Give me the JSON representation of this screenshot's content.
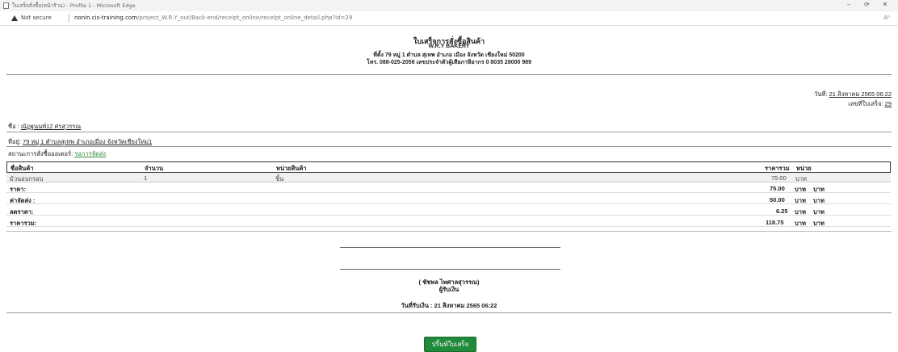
{
  "window": {
    "title": "ใบเสร็จสั่งซื้อ(หน้าร้าน) - Profile 1 - Microsoft Edge",
    "minimize": "–",
    "restore": "⟳",
    "close": "✕"
  },
  "addressbar": {
    "security_label": "Not secure",
    "url_host": "nonin.cis-training.com",
    "url_path": "/project_W.R.Y_out/Back-end/receipt_online/receipt_online_detail.php?id=29",
    "reader_label": "Aᵇ"
  },
  "header": {
    "title": "ใบเสร็จการสั่งซื้อสินค้า",
    "shop_name": "W.R.Y BAKERY",
    "address": "ที่ตั้ง 79 หมู่ 1 ตำบล สุเทพ อำเภอ เมือง จังหวัด เชียงใหม่ 50200",
    "contact": "โทร. 088-025-2056 เลขประจำตัวผู้เสียภาษีอากร 0 8035 28000 989"
  },
  "receipt_meta": {
    "date_label": "วันที่:",
    "date_value": "21 สิงหาคม 2565 06:22",
    "number_label": "เลขที่ใบเสร็จ:",
    "number_value": "29"
  },
  "customer": {
    "name_label": "ชื่อ :",
    "name_value": "ณัฏฐนนท์12 ศรสุวรรณ",
    "address_label": "ที่อยู่:",
    "address_value": "79 หมู่ 1 ตำบลสุเทพ อำเภอเมือง จังหวัดเชียงใหม่1",
    "status_label": "สถานะการสั่งซื้อออเดอร์:",
    "status_value": "รอการจัดส่ง"
  },
  "items_table": {
    "headers": [
      "ชื่อสินค้า",
      "จำนวน",
      "หน่วยสินค้า",
      "ราคารวม",
      "หน่วย"
    ],
    "rows": [
      {
        "name": "ม้วนอบกรอบ",
        "qty": "1",
        "unit": "ชิ้น",
        "total": "75.00",
        "currency": "บาท"
      }
    ]
  },
  "summary": [
    {
      "label": "ราคา:",
      "value": "75.00",
      "currency": "บาท",
      "unit": "บาท"
    },
    {
      "label": "ค่าจัดส่ง :",
      "value": "50.00",
      "currency": "บาท",
      "unit": "บาท"
    },
    {
      "label": "ลดราคา:",
      "value": "6.25",
      "currency": "บาท",
      "unit": "บาท"
    },
    {
      "label": "ราคารวม:",
      "value": "118.75",
      "currency": "บาท",
      "unit": "บาท"
    }
  ],
  "signature": {
    "name": "( ชัชพล ไพศาลสุวรรณ)",
    "role": "ผู้รับเงิน",
    "paid_date": "วันที่รับเงิน : 21 สิงหาคม 2565 06:22"
  },
  "actions": {
    "print_label": "ปริ้นท์ใบเสร็จ"
  },
  "colors": {
    "status_green": "#2e8b3c",
    "print_button": "#1f8a3a"
  }
}
